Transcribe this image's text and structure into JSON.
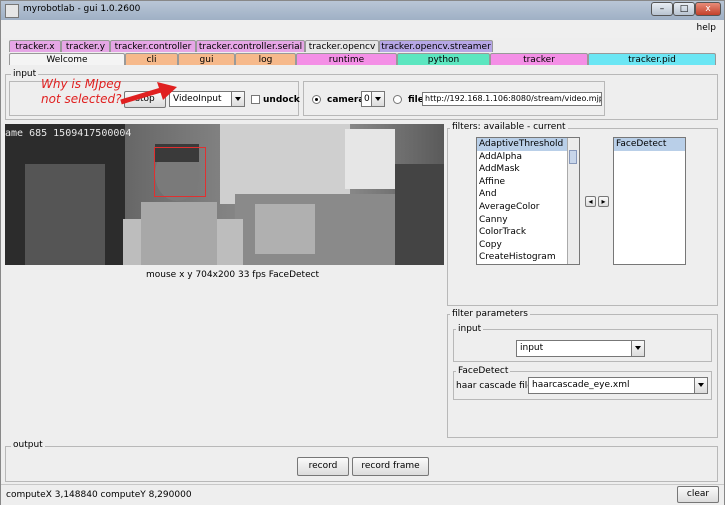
{
  "window": {
    "title": "myrobotlab - gui 1.0.2600",
    "minimize": "–",
    "maximize": "□",
    "close": "x"
  },
  "menu": {
    "help": "help"
  },
  "tabs_row1": [
    {
      "label": "tracker.x",
      "color": "#e6a6e6"
    },
    {
      "label": "tracker.y",
      "color": "#e6a6e6"
    },
    {
      "label": "tracker.controller",
      "color": "#e6a6e6"
    },
    {
      "label": "tracker.controller.serial",
      "color": "#e6a6e6"
    },
    {
      "label": "tracker.opencv",
      "color": "#e6e6e6"
    },
    {
      "label": "tracker.opencv.streamer",
      "color": "#b6a6e6"
    }
  ],
  "tabs_row2": [
    {
      "label": "Welcome",
      "color": "#f4f4f4"
    },
    {
      "label": "cli",
      "color": "#f6b98b"
    },
    {
      "label": "gui",
      "color": "#f6b98b"
    },
    {
      "label": "log",
      "color": "#f6b98b"
    },
    {
      "label": "runtime",
      "color": "#f48fe6"
    },
    {
      "label": "python",
      "color": "#5ce6c0"
    },
    {
      "label": "tracker",
      "color": "#f48fe6"
    },
    {
      "label": "tracker.pid",
      "color": "#6be6f4"
    }
  ],
  "input": {
    "label": "input",
    "stop_button": "stop",
    "grabber_select": "VideoInput",
    "undock_label": "undock",
    "camera_label": "camera",
    "camera_index": "0",
    "file_label": "file",
    "url_value": "http://192.168.1.106:8080/stream/video.mjpeg"
  },
  "annotation": {
    "text_line1": "Why is MJpeg",
    "text_line2": "not selected?",
    "color": "#e02020"
  },
  "video": {
    "overlay_text": "ame 685 1509417500004",
    "status_line": "mouse x y 704x200  33 fps FaceDetect"
  },
  "filters": {
    "label": "filters: available - current",
    "available": [
      "AdaptiveThreshold",
      "AddAlpha",
      "AddMask",
      "Affine",
      "And",
      "AverageColor",
      "Canny",
      "ColorTrack",
      "Copy",
      "CreateHistogram"
    ],
    "current": [
      "FaceDetect"
    ],
    "left_arrow": "◂",
    "right_arrow": "▸"
  },
  "filter_params": {
    "label": "filter parameters",
    "input_label": "input",
    "input_select": "input",
    "facedetect_label": "FaceDetect",
    "cascade_label": "haar cascade file",
    "cascade_select": "haarcascade_eye.xml"
  },
  "output": {
    "label": "output",
    "record_button": "record",
    "record_frame_button": "record frame"
  },
  "statusbar": {
    "text": "computeX 3,148840 computeY 8,290000",
    "clear_button": "clear"
  }
}
